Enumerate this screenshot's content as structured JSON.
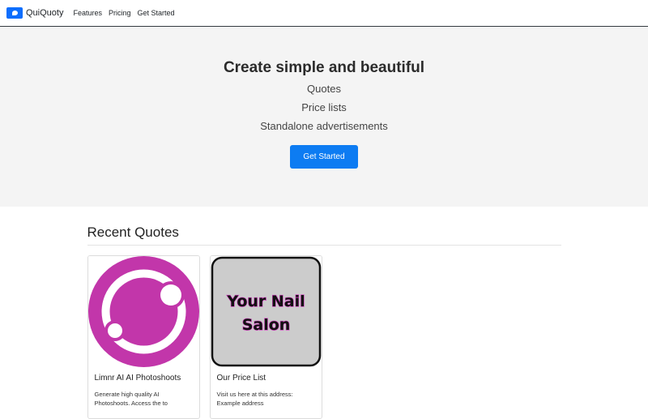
{
  "nav": {
    "brand": "QuiQuoty",
    "links": [
      "Features",
      "Pricing",
      "Get Started"
    ]
  },
  "hero": {
    "title": "Create simple and beautiful",
    "lines": [
      "Quotes",
      "Price lists",
      "Standalone advertisements"
    ],
    "cta": "Get Started"
  },
  "recent": {
    "heading": "Recent Quotes",
    "cards": [
      {
        "title": "Limnr AI AI Photoshoots",
        "text": "Generate high quality AI Photoshoots. Access the to",
        "image": "pink-circle-logo"
      },
      {
        "title": "Our Price List",
        "text": "Visit us here at this address: Example address",
        "image": "your-nail-salon-sign",
        "image_text": [
          "Your Nail",
          "Salon"
        ]
      }
    ]
  },
  "colors": {
    "primary": "#0d7cf2",
    "hero_bg": "#f4f4f4",
    "logo_pink": "#c236aa",
    "sign_gray": "#cccccc"
  }
}
